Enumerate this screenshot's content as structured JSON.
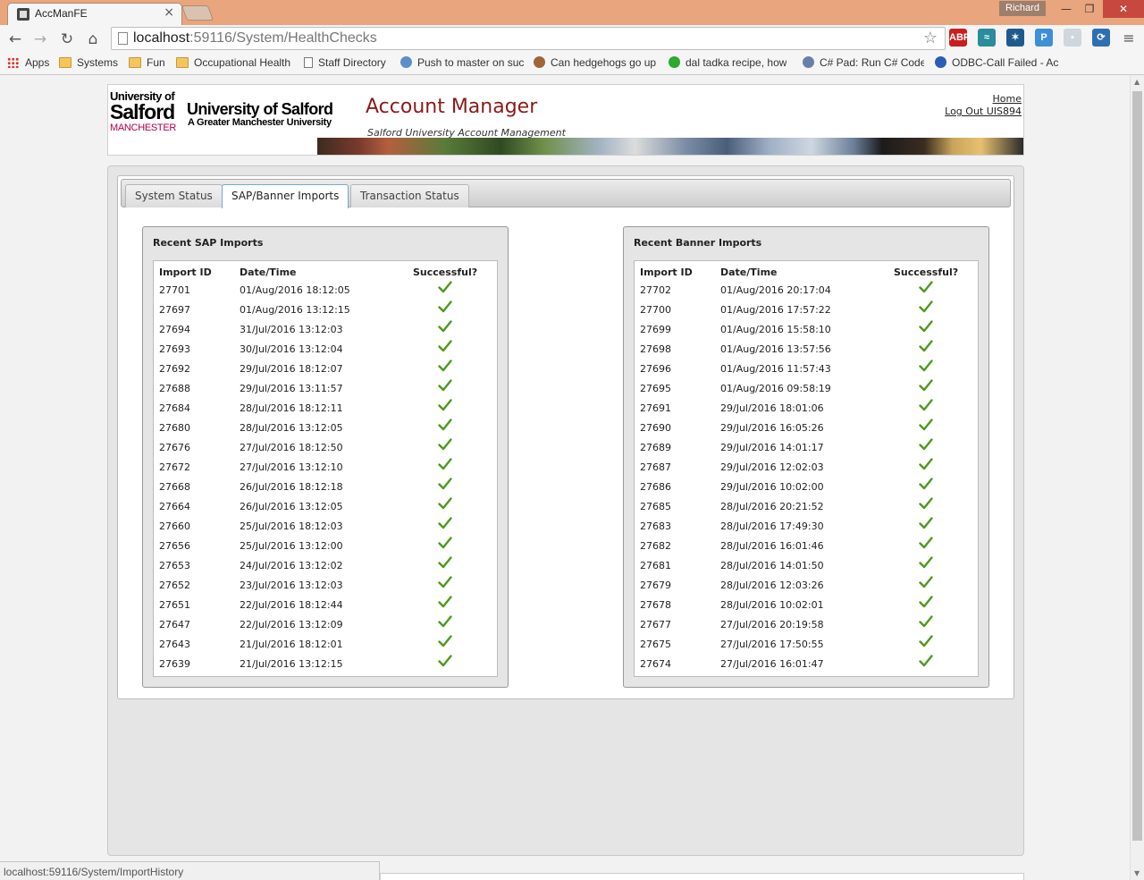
{
  "browser": {
    "tab_title": "AccManFE",
    "tab_close": "×",
    "user": "Richard",
    "win_min": "—",
    "win_max": "❐",
    "win_close": "✕",
    "url_host": "localhost",
    "url_path": ":59116/System/HealthChecks",
    "status_url": "localhost:59116/System/ImportHistory",
    "nav": {
      "back": "←",
      "forward": "→",
      "reload": "↻",
      "home": "⌂"
    },
    "extensions": [
      {
        "icon": "abp-icon",
        "label": "ABP",
        "color": "#c81e1e"
      },
      {
        "icon": "wave-icon",
        "label": "≈",
        "color": "#2a8c9c"
      },
      {
        "icon": "runner-icon",
        "label": "✶",
        "color": "#1f5a8f"
      },
      {
        "icon": "p-icon",
        "label": "P",
        "color": "#3d8fd9"
      },
      {
        "icon": "chart-ext-icon",
        "label": "▪",
        "color": "#cfd6dc"
      },
      {
        "icon": "sync-icon",
        "label": "⟳",
        "color": "#2e6fb4"
      }
    ],
    "bookmarks": [
      {
        "label": "Apps",
        "icon": "apps-grid-icon"
      },
      {
        "label": "Systems",
        "icon": "folder-icon"
      },
      {
        "label": "Fun",
        "icon": "folder-icon"
      },
      {
        "label": "Occupational Health",
        "icon": "folder-icon"
      },
      {
        "label": "Staff Directory",
        "icon": "page-icon"
      },
      {
        "label": "Push to master on suc",
        "icon": "jenkins-icon"
      },
      {
        "label": "Can hedgehogs go up",
        "icon": "hedgehog-icon"
      },
      {
        "label": "dal tadka recipe, how",
        "icon": "veg-icon"
      },
      {
        "label": "C# Pad: Run C# Code",
        "icon": "csharp-icon"
      },
      {
        "label": "ODBC-Call Failed - Ac",
        "icon": "odbc-icon"
      }
    ]
  },
  "header": {
    "logo_line1": "University of",
    "logo_line2": "Salford",
    "logo_line3": "MANCHESTER",
    "logo_name": "University of Salford",
    "logo_sub": "A Greater Manchester University",
    "title": "Account Manager",
    "subtitle": "Salford University Account Management",
    "link_home": "Home",
    "link_logout": "Log Out UIS894"
  },
  "tabs": [
    "System Status",
    "SAP/Banner Imports",
    "Transaction Status"
  ],
  "active_tab": "SAP/Banner Imports",
  "columns": {
    "id": "Import ID",
    "date": "Date/Time",
    "success": "Successful?"
  },
  "sap": {
    "title": "Recent SAP Imports",
    "rows": [
      {
        "id": "27701",
        "date": "01/Aug/2016 18:12:05",
        "ok": true
      },
      {
        "id": "27697",
        "date": "01/Aug/2016 13:12:15",
        "ok": true
      },
      {
        "id": "27694",
        "date": "31/Jul/2016 13:12:03",
        "ok": true
      },
      {
        "id": "27693",
        "date": "30/Jul/2016 13:12:04",
        "ok": true
      },
      {
        "id": "27692",
        "date": "29/Jul/2016 18:12:07",
        "ok": true
      },
      {
        "id": "27688",
        "date": "29/Jul/2016 13:11:57",
        "ok": true
      },
      {
        "id": "27684",
        "date": "28/Jul/2016 18:12:11",
        "ok": true
      },
      {
        "id": "27680",
        "date": "28/Jul/2016 13:12:05",
        "ok": true
      },
      {
        "id": "27676",
        "date": "27/Jul/2016 18:12:50",
        "ok": true
      },
      {
        "id": "27672",
        "date": "27/Jul/2016 13:12:10",
        "ok": true
      },
      {
        "id": "27668",
        "date": "26/Jul/2016 18:12:18",
        "ok": true
      },
      {
        "id": "27664",
        "date": "26/Jul/2016 13:12:05",
        "ok": true
      },
      {
        "id": "27660",
        "date": "25/Jul/2016 18:12:03",
        "ok": true
      },
      {
        "id": "27656",
        "date": "25/Jul/2016 13:12:00",
        "ok": true
      },
      {
        "id": "27653",
        "date": "24/Jul/2016 13:12:02",
        "ok": true
      },
      {
        "id": "27652",
        "date": "23/Jul/2016 13:12:03",
        "ok": true
      },
      {
        "id": "27651",
        "date": "22/Jul/2016 18:12:44",
        "ok": true
      },
      {
        "id": "27647",
        "date": "22/Jul/2016 13:12:09",
        "ok": true
      },
      {
        "id": "27643",
        "date": "21/Jul/2016 18:12:01",
        "ok": true
      },
      {
        "id": "27639",
        "date": "21/Jul/2016 13:12:15",
        "ok": true
      }
    ]
  },
  "banner": {
    "title": "Recent Banner Imports",
    "rows": [
      {
        "id": "27702",
        "date": "01/Aug/2016 20:17:04",
        "ok": true
      },
      {
        "id": "27700",
        "date": "01/Aug/2016 17:57:22",
        "ok": true
      },
      {
        "id": "27699",
        "date": "01/Aug/2016 15:58:10",
        "ok": true
      },
      {
        "id": "27698",
        "date": "01/Aug/2016 13:57:56",
        "ok": true
      },
      {
        "id": "27696",
        "date": "01/Aug/2016 11:57:43",
        "ok": true
      },
      {
        "id": "27695",
        "date": "01/Aug/2016 09:58:19",
        "ok": true
      },
      {
        "id": "27691",
        "date": "29/Jul/2016 18:01:06",
        "ok": true
      },
      {
        "id": "27690",
        "date": "29/Jul/2016 16:05:26",
        "ok": true
      },
      {
        "id": "27689",
        "date": "29/Jul/2016 14:01:17",
        "ok": true
      },
      {
        "id": "27687",
        "date": "29/Jul/2016 12:02:03",
        "ok": true
      },
      {
        "id": "27686",
        "date": "29/Jul/2016 10:02:00",
        "ok": true
      },
      {
        "id": "27685",
        "date": "28/Jul/2016 20:21:52",
        "ok": true
      },
      {
        "id": "27683",
        "date": "28/Jul/2016 17:49:30",
        "ok": true
      },
      {
        "id": "27682",
        "date": "28/Jul/2016 16:01:46",
        "ok": true
      },
      {
        "id": "27681",
        "date": "28/Jul/2016 14:01:50",
        "ok": true
      },
      {
        "id": "27679",
        "date": "28/Jul/2016 12:03:26",
        "ok": true
      },
      {
        "id": "27678",
        "date": "28/Jul/2016 10:02:01",
        "ok": true
      },
      {
        "id": "27677",
        "date": "27/Jul/2016 20:19:58",
        "ok": true
      },
      {
        "id": "27675",
        "date": "27/Jul/2016 17:50:55",
        "ok": true
      },
      {
        "id": "27674",
        "date": "27/Jul/2016 16:01:47",
        "ok": true
      }
    ]
  },
  "colors": {
    "success": "#4c9a1c",
    "title": "#8b1a1a"
  }
}
